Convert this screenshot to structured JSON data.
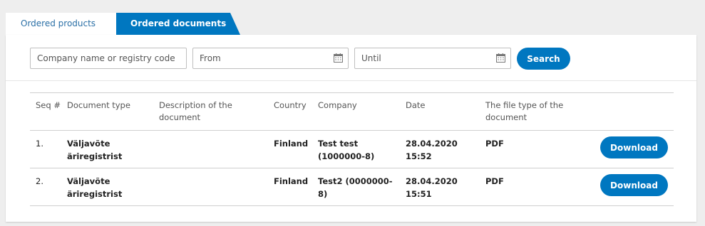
{
  "tabs": {
    "ordered_products": "Ordered products",
    "ordered_documents": "Ordered documents"
  },
  "filters": {
    "company_placeholder": "Company name or registry code",
    "from_placeholder": "From",
    "until_placeholder": "Until",
    "search_label": "Search"
  },
  "table": {
    "headers": {
      "seq": "Seq #",
      "doc_type": "Document type",
      "description": "Description of the document",
      "country": "Country",
      "company": "Company",
      "date": "Date",
      "file_type": "The file type of the document"
    },
    "rows": [
      {
        "seq": "1.",
        "doc_type": "Väljavõte äriregistrist",
        "description": "",
        "country": "Finland",
        "company": "Test test (1000000-8)",
        "date": "28.04.2020 15:52",
        "file_type": "PDF",
        "action": "Download"
      },
      {
        "seq": "2.",
        "doc_type": "Väljavõte äriregistrist",
        "description": "",
        "country": "Finland",
        "company": "Test2 (0000000-8)",
        "date": "28.04.2020 15:51",
        "file_type": "PDF",
        "action": "Download"
      }
    ]
  },
  "colors": {
    "accent": "#0077c0",
    "background": "#eeeeee"
  },
  "icons": {
    "date_picker": "calendar-icon"
  }
}
